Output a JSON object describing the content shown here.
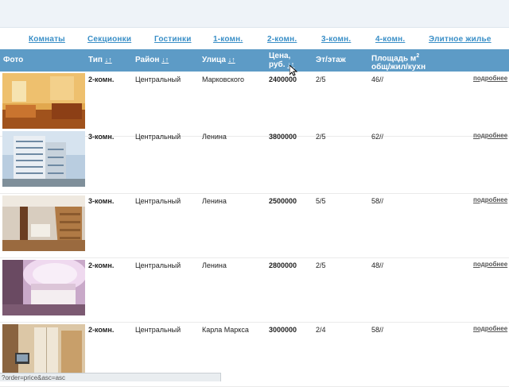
{
  "nav": [
    {
      "label": "Комнаты"
    },
    {
      "label": "Секционки"
    },
    {
      "label": "Гостинки"
    },
    {
      "label": "1-комн."
    },
    {
      "label": "2-комн."
    },
    {
      "label": "3-комн."
    },
    {
      "label": "4-комн."
    },
    {
      "label": "Элитное жилье"
    }
  ],
  "table": {
    "headers": {
      "photo": "Фото",
      "type": "Тип",
      "district": "Район",
      "street": "Улица",
      "price_l1": "Цена,",
      "price_l2": "руб.",
      "floor": "Эт/этаж",
      "area_l1": "Площадь м",
      "area_sup": "2",
      "area_l2": "общ/жил/кухн",
      "sort_arrows": "↓↑"
    },
    "more_label": "подробнее",
    "rows": [
      {
        "type": "2-комн.",
        "district": "Центральный",
        "street": "Марковского",
        "price": "2400000",
        "floor": "2/5",
        "area": "46//"
      },
      {
        "type": "3-комн.",
        "district": "Центральный",
        "street": "Ленина",
        "price": "3800000",
        "floor": "2/5",
        "area": "62//"
      },
      {
        "type": "3-комн.",
        "district": "Центральный",
        "street": "Ленина",
        "price": "2500000",
        "floor": "5/5",
        "area": "58//"
      },
      {
        "type": "2-комн.",
        "district": "Центральный",
        "street": "Ленина",
        "price": "2800000",
        "floor": "2/5",
        "area": "48//"
      },
      {
        "type": "2-комн.",
        "district": "Центральный",
        "street": "Карла Маркса",
        "price": "3000000",
        "floor": "2/4",
        "area": "58//"
      }
    ]
  },
  "status_url": "?order=price&asc=asc"
}
